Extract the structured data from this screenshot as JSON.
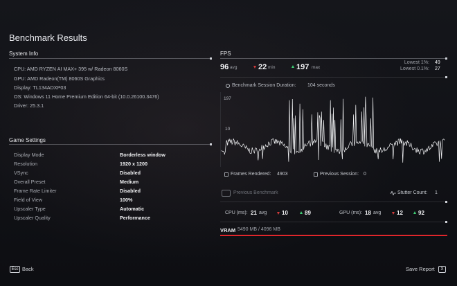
{
  "page_title": "Benchmark Results",
  "system_info": {
    "title": "System Info",
    "lines": [
      "CPU: AMD RYZEN AI MAX+ 395 w/ Radeon 8060S",
      "GPU: AMD Radeon(TM) 8060S Graphics",
      "Display: TL134ADXP03",
      "OS: Windows 11 Home Premium Edition 64-bit (10.0.26100.3476)",
      "Driver: 25.3.1"
    ]
  },
  "game_settings": {
    "title": "Game Settings",
    "rows": [
      {
        "label": "Display Mode",
        "value": "Borderless window"
      },
      {
        "label": "Resolution",
        "value": "1920 x 1200"
      },
      {
        "label": "VSync",
        "value": "Disabled"
      },
      {
        "label": "Overall Preset",
        "value": "Medium"
      },
      {
        "label": "Frame Rate Limiter",
        "value": "Disabled"
      },
      {
        "label": "Field of View",
        "value": "100%"
      },
      {
        "label": "Upscaler Type",
        "value": "Automatic"
      },
      {
        "label": "Upscaler Quality",
        "value": "Performance"
      }
    ]
  },
  "fps": {
    "title": "FPS",
    "avg": "96",
    "avg_label": "avg",
    "min": "22",
    "min_label": "min",
    "max": "197",
    "max_label": "max",
    "lowest1_label": "Lowest 1%:",
    "lowest1": "49",
    "lowest01_label": "Lowest 0.1%:",
    "lowest01": "27",
    "duration_label": "Benchmark Session Duration:",
    "duration": "104 seconds",
    "y_top": "197",
    "y_mid": "10",
    "frames_label": "Frames Rendered:",
    "frames": "4903",
    "prev_session_label": "Previous Session:",
    "prev_session": "0",
    "prev_benchmark": "Previous Benchmark",
    "stutter_label": "Stutter Count:",
    "stutter": "1"
  },
  "chart_data": {
    "type": "line",
    "series": [
      {
        "values": []
      }
    ],
    "ylim": [
      0,
      197
    ],
    "yticks": [
      "197",
      "10"
    ]
  },
  "cpu": {
    "label": "CPU (ms):",
    "avg": "21",
    "avg_label": "avg",
    "min": "10",
    "max": "89"
  },
  "gpu": {
    "label": "GPU (ms):",
    "avg": "18",
    "avg_label": "avg",
    "min": "12",
    "max": "92"
  },
  "vram": {
    "label": "VRAM",
    "value": "5490 MB / 4096 MB",
    "fill_fraction": 1.0,
    "color": "#e0262b"
  },
  "footer": {
    "back_key": "Esc",
    "back": "Back",
    "save": "Save Report",
    "save_key": "X"
  }
}
